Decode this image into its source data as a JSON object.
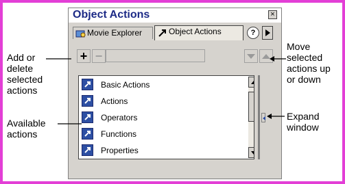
{
  "panel": {
    "title": "Object Actions",
    "close_glyph": "×",
    "tabs": [
      {
        "label": "Movie Explorer",
        "icon": "movie-explorer-icon",
        "active": false
      },
      {
        "label": "Object Actions",
        "icon": "object-actions-icon",
        "active": true
      }
    ],
    "help_glyph": "?",
    "toolbar": {
      "add_glyph": "+",
      "delete_glyph": "−"
    },
    "list_items": [
      "Basic Actions",
      "Actions",
      "Operators",
      "Functions",
      "Properties"
    ]
  },
  "callouts": {
    "add_delete": "Add or delete selected actions",
    "available": "Available actions",
    "move": "Move selected actions up or down",
    "expand": "Expand window"
  },
  "colors": {
    "frame": "#e33fd6",
    "title": "#1c2a86",
    "panel_bg": "#d6d3ce"
  }
}
